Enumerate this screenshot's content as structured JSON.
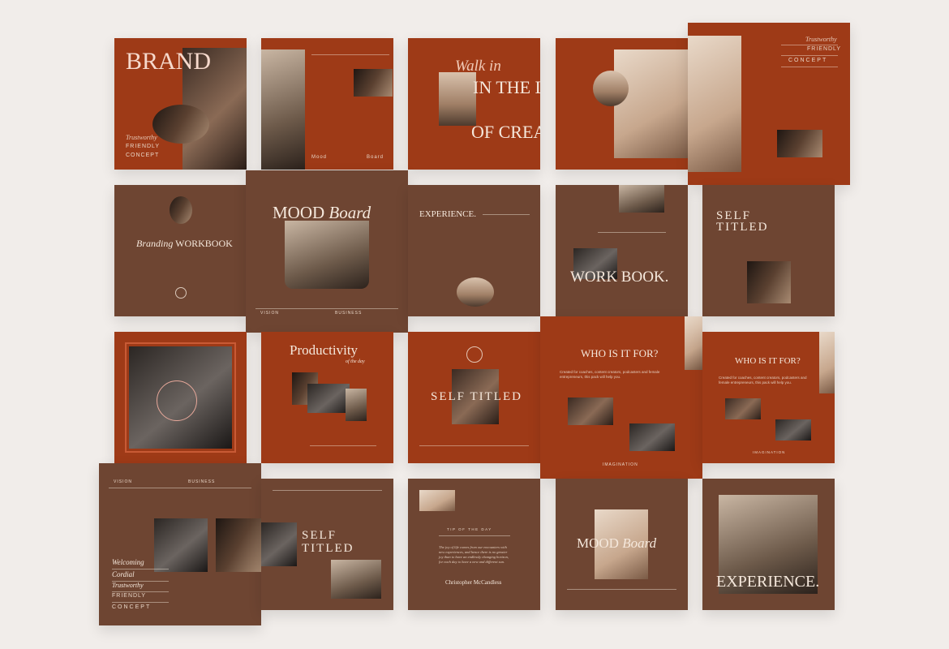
{
  "tiles": {
    "brand": {
      "title": "BRAND",
      "sub1": "Trustworthy",
      "sub2": "FRIENDLY",
      "sub3": "CONCEPT"
    },
    "mood_board_1": {
      "left": "Mood",
      "right": "Board"
    },
    "walk_in": {
      "script": "Walk in",
      "line1": "IN THE LIGHT",
      "line2": "OF CREATISM"
    },
    "trustworthy_concept": {
      "sub1": "Trustworthy",
      "sub2": "FRIENDLY",
      "sub3": "CONCEPT"
    },
    "branding_workbook": {
      "script": "Branding",
      "title": "WORKBOOK"
    },
    "mood_board_2": {
      "title": "MOOD",
      "script": "Board",
      "footer_left": "VISION",
      "footer_mid": "BUSINESS"
    },
    "experience_1": {
      "title": "EXPERIENCE."
    },
    "work_book": {
      "title": "WORK BOOK."
    },
    "self_titled_1": {
      "line1": "SELF",
      "line2": "TITLED"
    },
    "productivity": {
      "title": "Productivity",
      "script": "of the day"
    },
    "self_titled_2": {
      "title": "SELF TITLED"
    },
    "who_is_it_for_1": {
      "title": "WHO IS IT FOR?",
      "body": "Created for coaches, content creators, podcasters and female entrepreneurs, this pack will help you.",
      "footer": "IMAGINATION"
    },
    "who_is_it_for_2": {
      "title": "WHO IS IT FOR?",
      "body": "Created for coaches, content creators, podcasters and female entrepreneurs, this pack will help you.",
      "footer": "IMAGINATION"
    },
    "welcoming": {
      "header": "VISION",
      "header_mid": "BUSINESS",
      "l1": "Welcoming",
      "l2": "Cordial",
      "l3": "Trustworthy",
      "l4": "FRIENDLY",
      "l5": "CONCEPT"
    },
    "self_titled_3": {
      "line1": "SELF",
      "line2": "TITLED"
    },
    "tip_of_the_day": {
      "title": "TIP OF THE DAY",
      "quote": "The joy of life comes from our encounters with new experiences, and hence there is no greater joy than to have an endlessly changing horizon, for each day to have a new and different sun.",
      "author": "Christopher McCandless"
    },
    "mood_board_3": {
      "title": "MOOD",
      "script": "Board"
    },
    "experience_2": {
      "title": "EXPERIENCE."
    }
  }
}
